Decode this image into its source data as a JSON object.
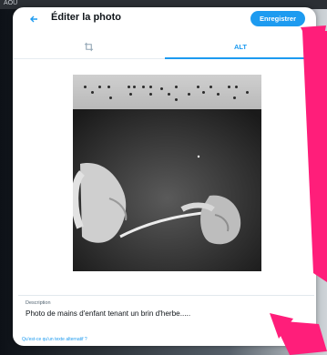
{
  "window": {
    "top_label": "AOU"
  },
  "header": {
    "back_icon": "arrow-left-icon",
    "title": "Éditer la photo",
    "save_label": "Enregistrer"
  },
  "tabs": [
    {
      "name": "crop",
      "icon": "crop-icon",
      "active": false
    },
    {
      "name": "alt",
      "label": "ALT",
      "active": true
    }
  ],
  "description": {
    "label": "Description",
    "text": "Photo de mains d'enfant tenant un brin d'herbe....."
  },
  "help_link": "Qu'est-ce qu'un texte alternatif ?",
  "colors": {
    "accent": "#1d9bf0",
    "annotation_arrow": "#ff1e7a"
  }
}
